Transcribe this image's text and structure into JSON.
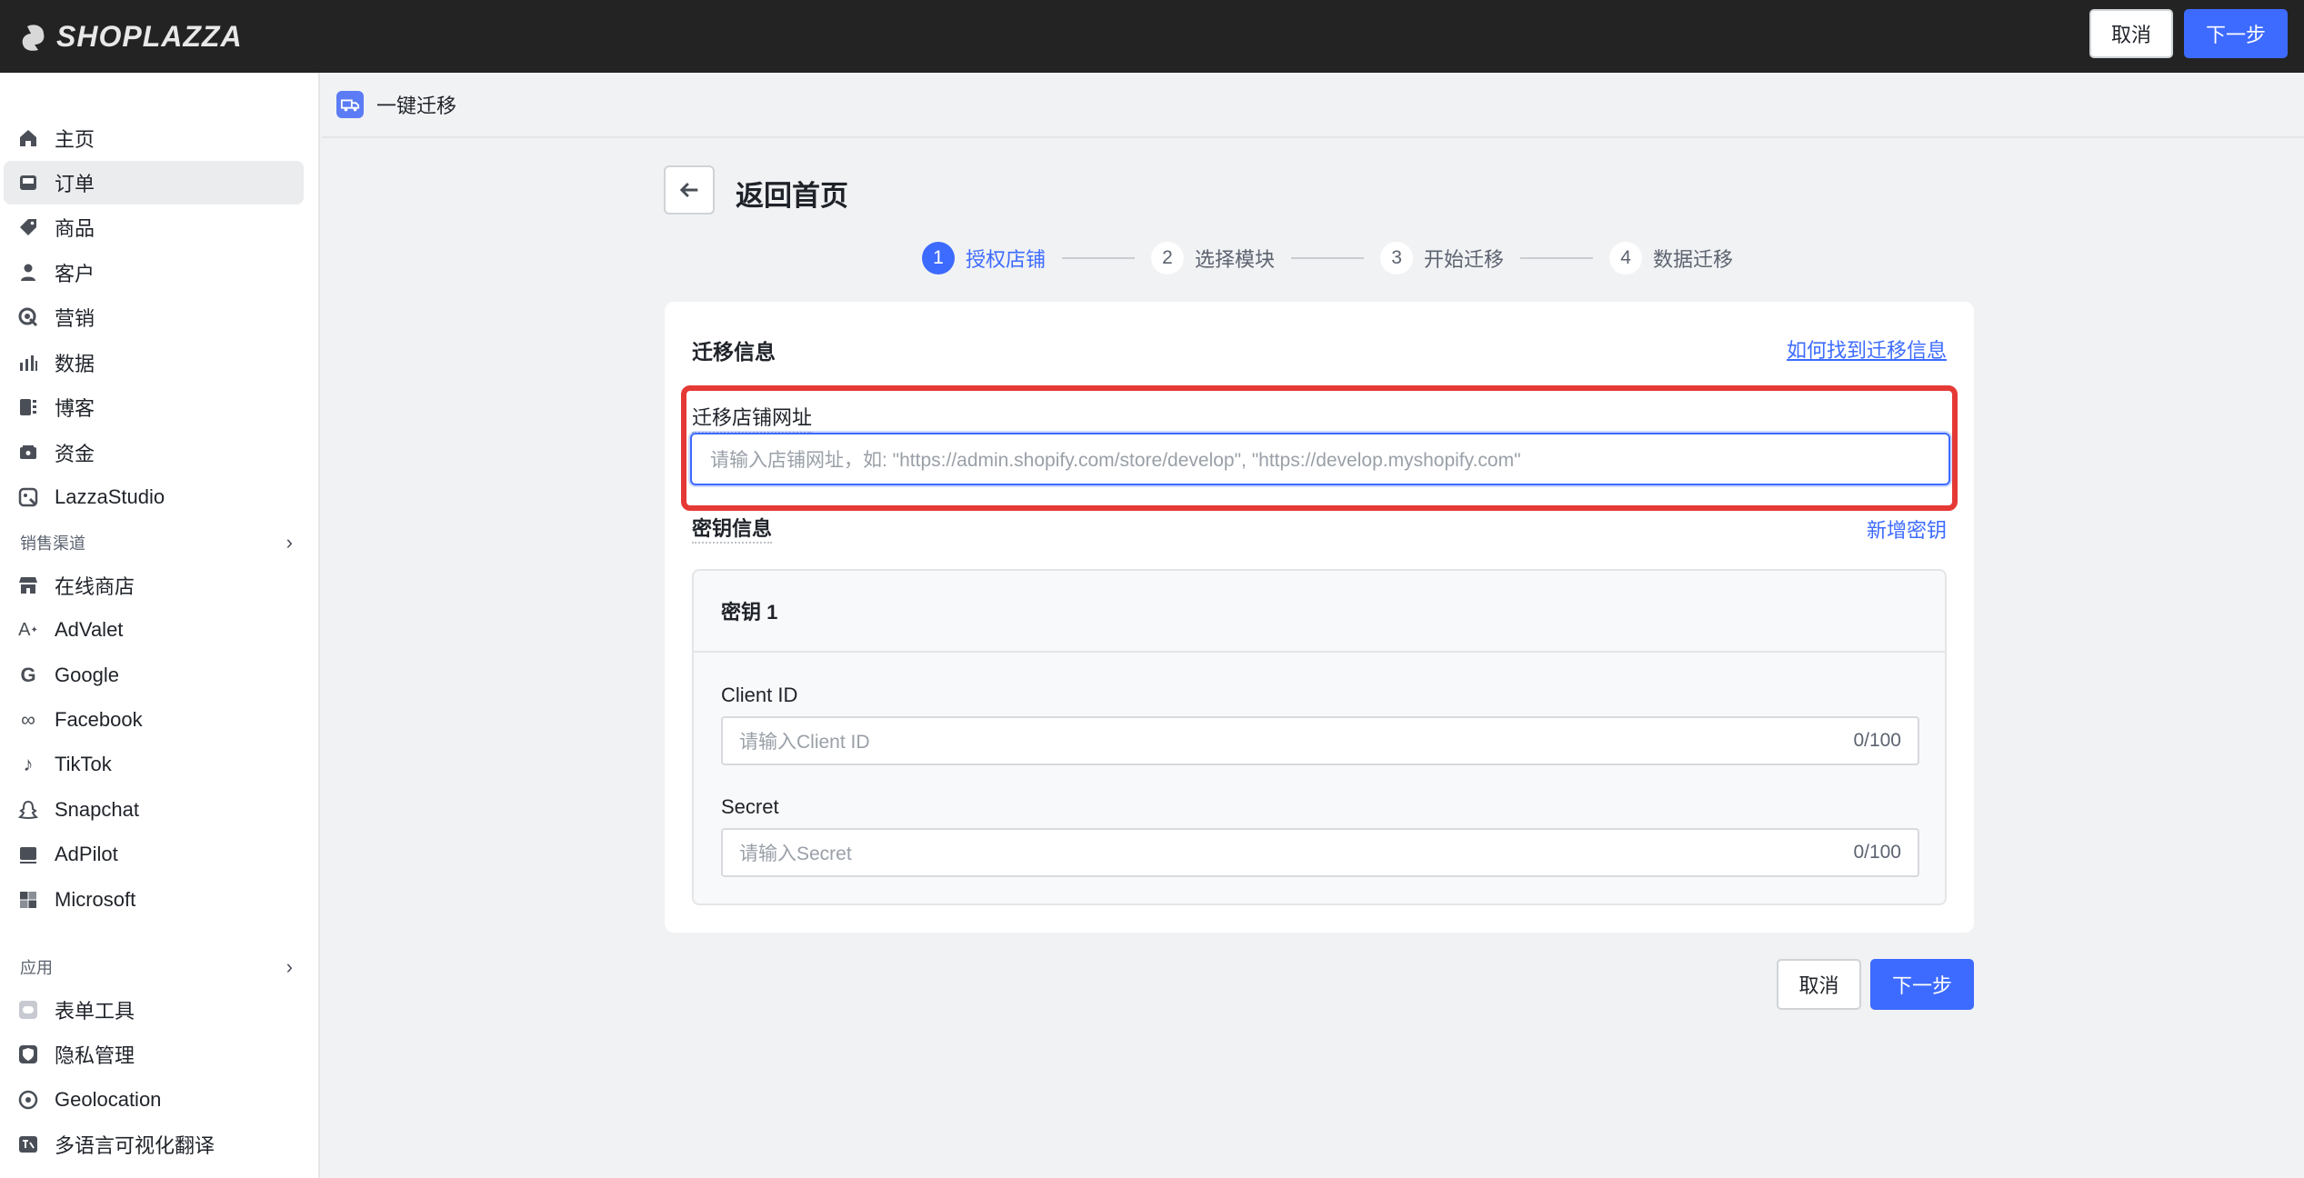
{
  "topbar": {
    "brand": "SHOPLAZZA",
    "cancel_label": "取消",
    "next_label": "下一步"
  },
  "sidebar": {
    "items": [
      {
        "label": "主页",
        "icon": "home-icon"
      },
      {
        "label": "订单",
        "icon": "inbox-icon"
      },
      {
        "label": "商品",
        "icon": "tag-icon"
      },
      {
        "label": "客户",
        "icon": "person-icon"
      },
      {
        "label": "营销",
        "icon": "target-icon"
      },
      {
        "label": "数据",
        "icon": "bar-chart-icon"
      },
      {
        "label": "博客",
        "icon": "blog-icon"
      },
      {
        "label": "资金",
        "icon": "wallet-icon"
      },
      {
        "label": "LazzaStudio",
        "icon": "studio-icon"
      }
    ],
    "sales_title": "销售渠道",
    "sales_items": [
      {
        "label": "在线商店",
        "icon": "store-icon"
      },
      {
        "label": "AdValet",
        "icon": "advalet-icon"
      },
      {
        "label": "Google",
        "icon": "google-icon"
      },
      {
        "label": "Facebook",
        "icon": "meta-icon"
      },
      {
        "label": "TikTok",
        "icon": "tiktok-icon"
      },
      {
        "label": "Snapchat",
        "icon": "snapchat-icon"
      },
      {
        "label": "AdPilot",
        "icon": "adpilot-icon"
      },
      {
        "label": "Microsoft",
        "icon": "microsoft-icon"
      }
    ],
    "apps_title": "应用",
    "app_items": [
      {
        "label": "表单工具",
        "icon": "form-icon"
      },
      {
        "label": "隐私管理",
        "icon": "shield-icon"
      },
      {
        "label": "Geolocation",
        "icon": "geolocation-icon"
      },
      {
        "label": "多语言可视化翻译",
        "icon": "translate-icon"
      }
    ]
  },
  "header": {
    "title": "一键迁移"
  },
  "page": {
    "back_title": "返回首页"
  },
  "steps": [
    {
      "num": "1",
      "label": "授权店铺",
      "active": true
    },
    {
      "num": "2",
      "label": "选择模块",
      "active": false
    },
    {
      "num": "3",
      "label": "开始迁移",
      "active": false
    },
    {
      "num": "4",
      "label": "数据迁移",
      "active": false
    }
  ],
  "card": {
    "title": "迁移信息",
    "help_link": "如何找到迁移信息",
    "url_label": "迁移店铺网址",
    "url_placeholder": "请输入店铺网址，如: \"https://admin.shopify.com/store/develop\", \"https://develop.myshopify.com\"",
    "key_section_title": "密钥信息",
    "add_key_link": "新增密钥",
    "key_box_title": "密钥 1",
    "client_id_label": "Client ID",
    "client_id_placeholder": "请输入Client ID",
    "client_id_counter": "0/100",
    "secret_label": "Secret",
    "secret_placeholder": "请输入Secret",
    "secret_counter": "0/100"
  },
  "footer": {
    "cancel_label": "取消",
    "next_label": "下一步"
  },
  "colors": {
    "accent": "#3d6bff",
    "highlight": "#e53935",
    "topbar": "#232323"
  }
}
